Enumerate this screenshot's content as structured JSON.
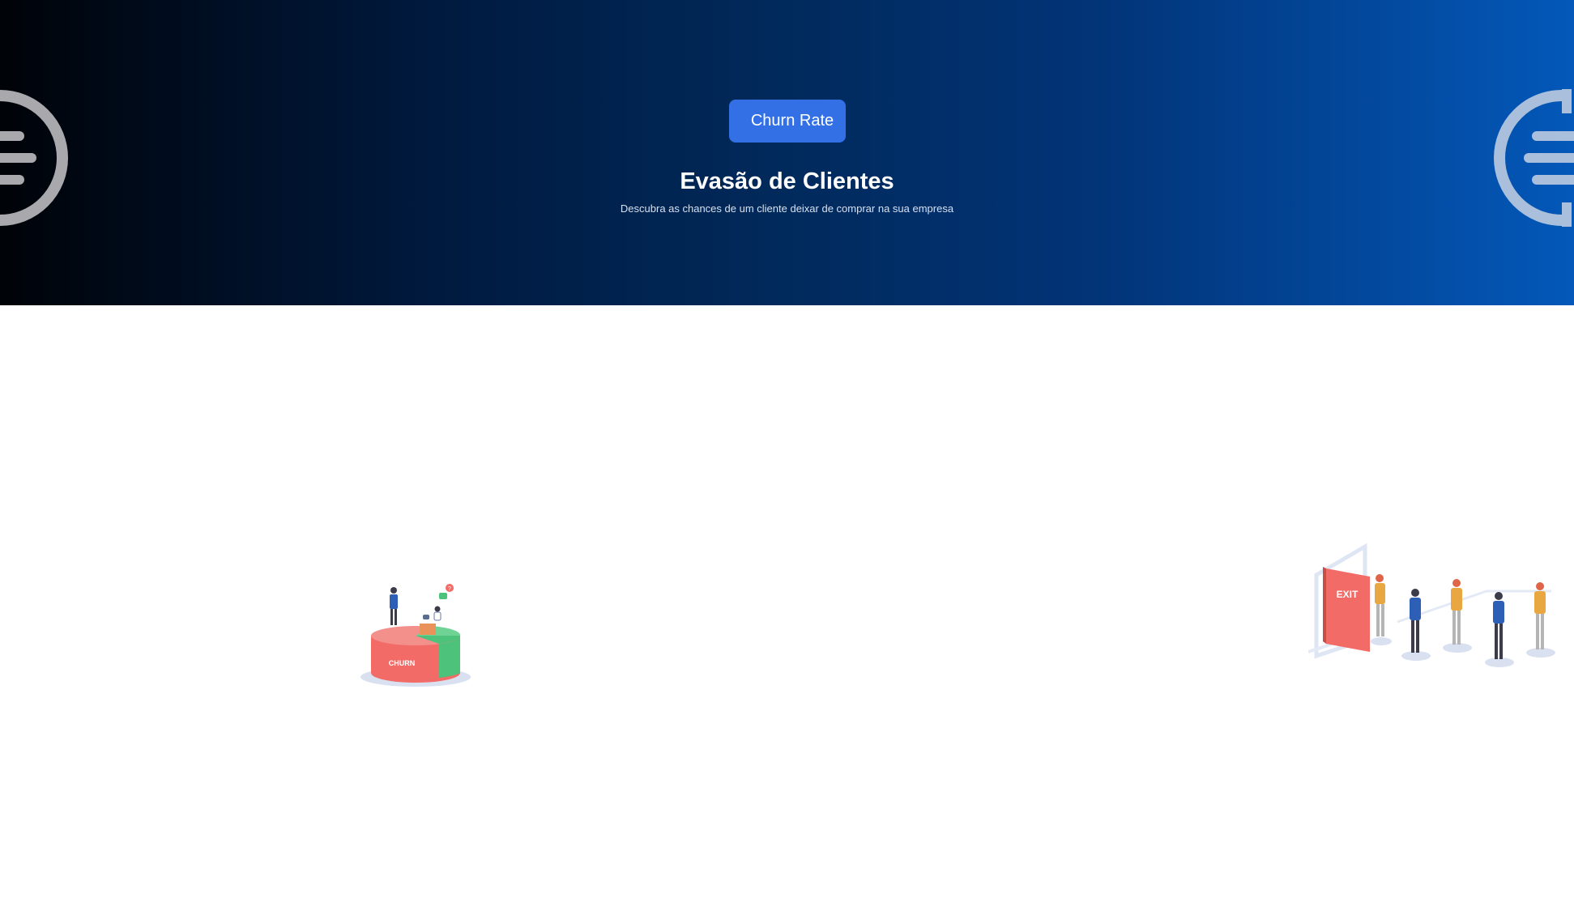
{
  "hero": {
    "badge_label": "Churn Rate",
    "title": "Evasão de Clientes",
    "subtitle": "Descubra as chances de um cliente deixar de comprar na sua empresa"
  },
  "illustrations": {
    "left_label": "CHURN",
    "right_label": "EXIT"
  },
  "colors": {
    "accent": "#3370e6",
    "hero_dark": "#000308",
    "hero_light": "#0358b9",
    "churn_red": "#f26b66",
    "churn_green": "#4cc27a"
  }
}
